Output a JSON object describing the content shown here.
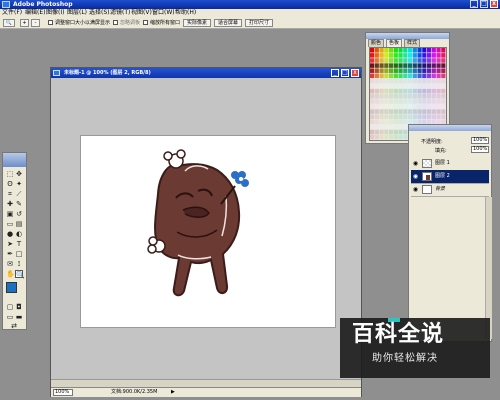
{
  "window": {
    "title": "Adobe Photoshop",
    "window_controls": [
      "_",
      "□",
      "x"
    ]
  },
  "menubar": {
    "items": [
      "文件(F)",
      "编辑(E)",
      "图像(I)",
      "图层(L)",
      "选择(S)",
      "滤镜(T)",
      "视图(V)",
      "窗口(W)",
      "帮助(H)"
    ]
  },
  "options_bar": {
    "zoom_icons": [
      "+",
      "-"
    ],
    "checkbox1_label": "调整窗口大小以满屏显示",
    "checkbox2_label": "忽略调板",
    "checkbox3_label": "缩放所有窗口",
    "btn_actual_pixels": "实际像素",
    "btn_fit_screen": "适合屏幕",
    "btn_print_size": "打印尺寸"
  },
  "document": {
    "title": "未标题-1 @ 100% (图层 2, RGB/8)",
    "zoom": "100%",
    "doc_info": "文档:900.0K/2.35M"
  },
  "swatches_panel": {
    "tab_color": "颜色",
    "tab_swatches": "色板",
    "tab_styles": "样式"
  },
  "layers_panel": {
    "opacity_label": "不透明度:",
    "opacity_value": "100%",
    "fill_label": "填充:",
    "fill_value": "100%",
    "layers": [
      {
        "name": "图层 1",
        "selected": false
      },
      {
        "name": "图层 2",
        "selected": true
      },
      {
        "name": "背景",
        "selected": false
      }
    ]
  },
  "colors": {
    "foreground": "#1d6fc1",
    "background": "#ffffff",
    "character_body": "#6b3a33",
    "character_outline": "#3a1d1a",
    "flower": "#2c6fc9"
  },
  "watermark": {
    "title": "百科全说",
    "subtitle": "助你轻松解决"
  }
}
